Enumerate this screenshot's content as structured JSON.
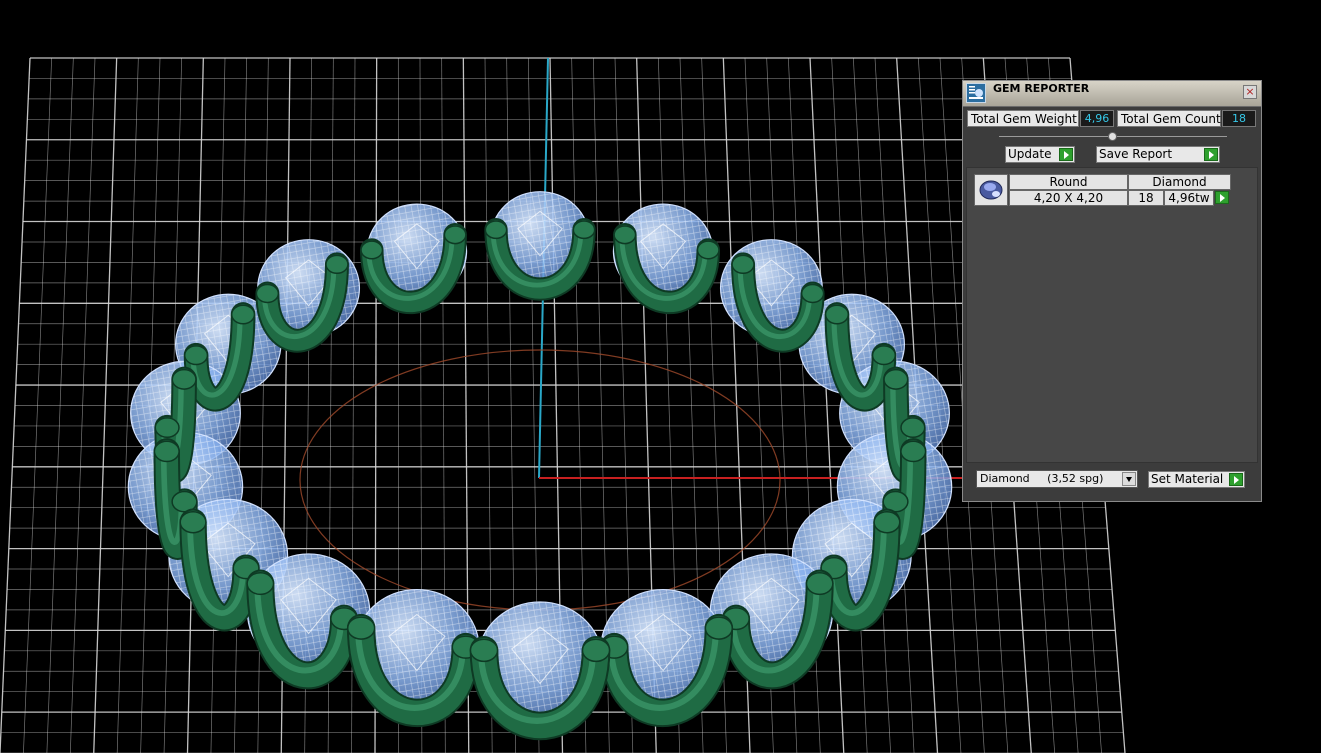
{
  "viewport": {
    "grid_color": "#d8d8d8",
    "axis_y_color": "#2aa8c8",
    "axis_x_color": "#c82020",
    "metal_color": "#1f6b44",
    "gem_color": "#8cb4f0"
  },
  "gem_reporter": {
    "title": "GEM REPORTER",
    "close_icon": "×",
    "total_weight_label": "Total Gem Weight",
    "total_weight_value": "4,96",
    "total_count_label": "Total Gem Count",
    "total_count_value": "18",
    "update_label": "Update",
    "save_report_label": "Save Report",
    "rows": [
      {
        "shape": "Round",
        "size": "4,20 X 4,20",
        "material": "Diamond",
        "count": "18",
        "weight": "4,96tw"
      }
    ],
    "material_select_value": "Diamond     (3,52 spg)",
    "set_material_label": "Set Material"
  }
}
